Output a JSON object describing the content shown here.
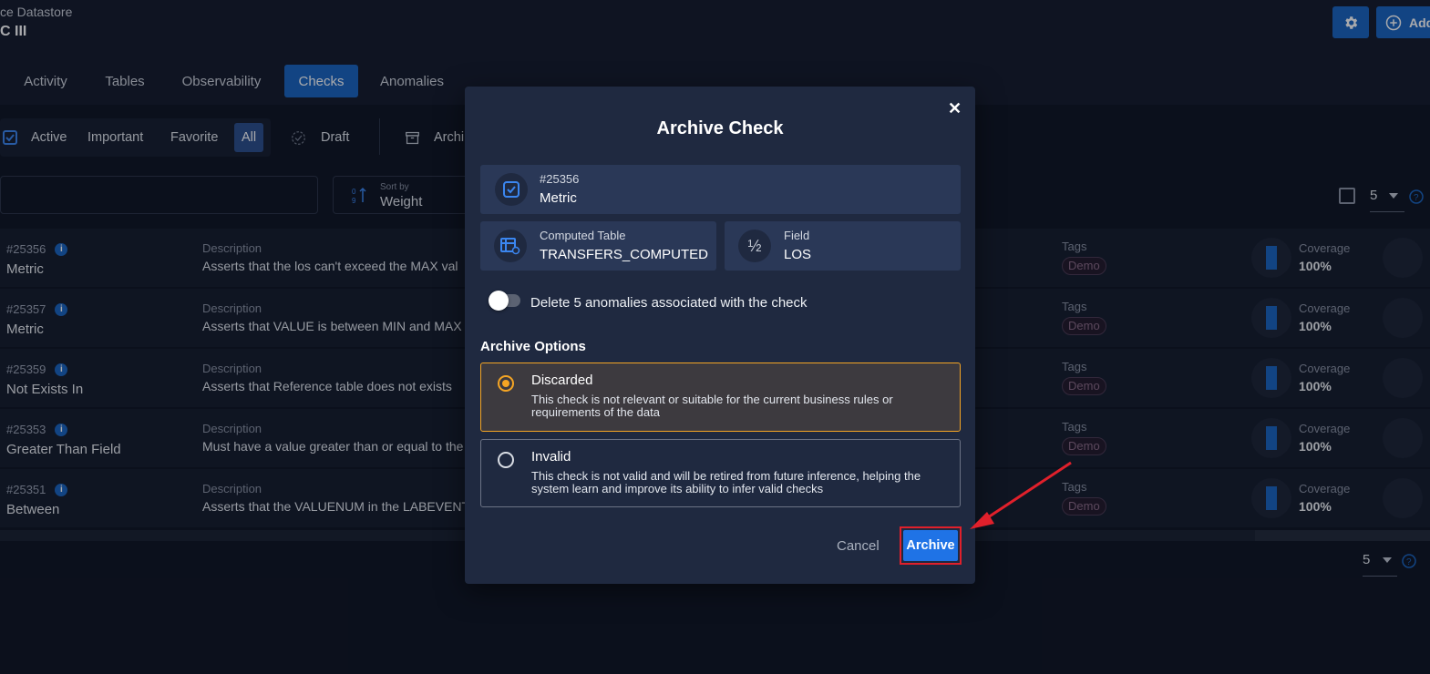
{
  "header": {
    "breadcrumb": "ce Datastore",
    "title": "C III",
    "add_label": "Add"
  },
  "tabs": [
    {
      "label": "Activity"
    },
    {
      "label": "Tables"
    },
    {
      "label": "Observability"
    },
    {
      "label": "Checks",
      "active": true
    },
    {
      "label": "Anomalies"
    }
  ],
  "filters": {
    "active": "Active",
    "important": "Important",
    "favorite": "Favorite",
    "all": "All",
    "draft": "Draft",
    "archived": "Archi"
  },
  "sort": {
    "label": "Sort by",
    "value": "Weight"
  },
  "pagination": {
    "page_size": "5",
    "page_size_bottom": "5"
  },
  "rows": [
    {
      "id": "#25356",
      "type": "Metric",
      "desc_label": "Description",
      "desc": "Asserts that the los can't exceed the MAX val",
      "tags_label": "Tags",
      "tag": "Demo",
      "coverage_label": "Coverage",
      "coverage": "100%"
    },
    {
      "id": "#25357",
      "type": "Metric",
      "desc_label": "Description",
      "desc": "Asserts that VALUE is between MIN and MAX",
      "tags_label": "Tags",
      "tag": "Demo",
      "coverage_label": "Coverage",
      "coverage": "100%"
    },
    {
      "id": "#25359",
      "type": "Not Exists In",
      "desc_label": "Description",
      "desc": "Asserts that Reference table does not exists",
      "tags_label": "Tags",
      "tag": "Demo",
      "coverage_label": "Coverage",
      "coverage": "100%"
    },
    {
      "id": "#25353",
      "type": "Greater Than Field",
      "desc_label": "Description",
      "desc": "Must have a value greater than or equal to the",
      "tags_label": "Tags",
      "tag": "Demo",
      "coverage_label": "Coverage",
      "coverage": "100%"
    },
    {
      "id": "#25351",
      "type": "Between",
      "desc_label": "Description",
      "desc": "Asserts that the VALUENUM in the LABEVENT",
      "tags_label": "Tags",
      "tag": "Demo",
      "coverage_label": "Coverage",
      "coverage": "100%"
    }
  ],
  "modal": {
    "title": "Archive Check",
    "check": {
      "id": "#25356",
      "type": "Metric"
    },
    "table": {
      "label": "Computed Table",
      "value": "TRANSFERS_COMPUTED"
    },
    "field": {
      "label": "Field",
      "value": "LOS"
    },
    "toggle_label": "Delete 5 anomalies associated with the check",
    "toggle_on": false,
    "options_heading": "Archive Options",
    "options": [
      {
        "title": "Discarded",
        "desc": "This check is not relevant or suitable for the current business rules or requirements of the data",
        "selected": true
      },
      {
        "title": "Invalid",
        "desc": "This check is not valid and will be retired from future inference, helping the system learn and improve its ability to infer valid checks",
        "selected": false
      }
    ],
    "cancel_label": "Cancel",
    "archive_label": "Archive"
  },
  "colors": {
    "accent": "#1a65c0",
    "selected_option": "#f5a524",
    "highlight": "#e0202b"
  }
}
